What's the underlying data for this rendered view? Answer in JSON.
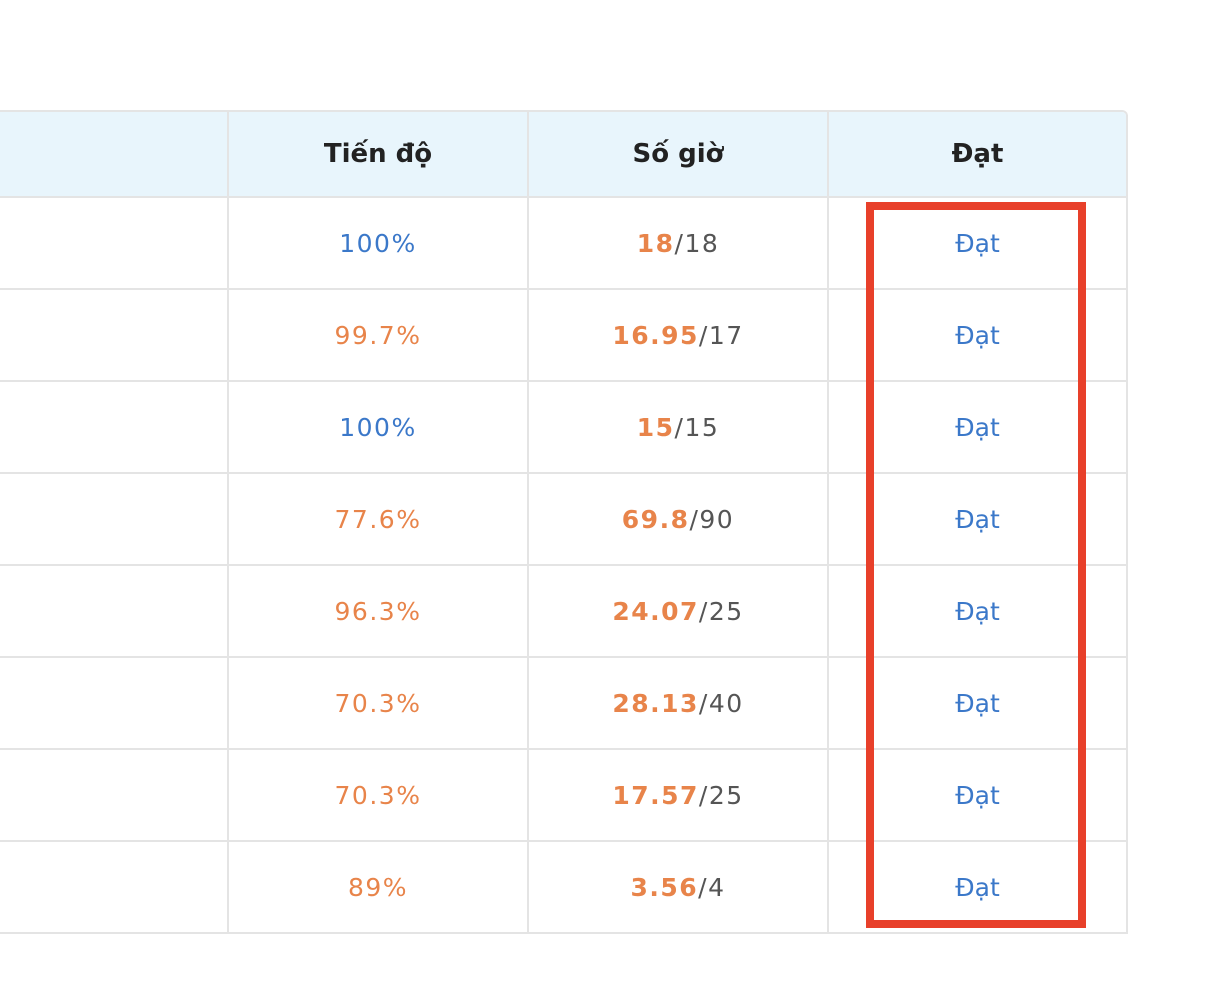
{
  "table": {
    "headers": {
      "name": "",
      "progress": "Tiến độ",
      "hours": "Số giờ",
      "pass": "Đạt"
    },
    "rows": [
      {
        "progress": "100%",
        "progress_status": "complete",
        "hours_done": "18",
        "hours_total": "18",
        "pass": "Đạt"
      },
      {
        "progress": "99.7%",
        "progress_status": "partial",
        "hours_done": "16.95",
        "hours_total": "17",
        "pass": "Đạt"
      },
      {
        "progress": "100%",
        "progress_status": "complete",
        "hours_done": "15",
        "hours_total": "15",
        "pass": "Đạt"
      },
      {
        "progress": "77.6%",
        "progress_status": "partial",
        "hours_done": "69.8",
        "hours_total": "90",
        "pass": "Đạt"
      },
      {
        "progress": "96.3%",
        "progress_status": "partial",
        "hours_done": "24.07",
        "hours_total": "25",
        "pass": "Đạt"
      },
      {
        "progress": "70.3%",
        "progress_status": "partial",
        "hours_done": "28.13",
        "hours_total": "40",
        "pass": "Đạt"
      },
      {
        "progress": "70.3%",
        "progress_status": "partial",
        "hours_done": "17.57",
        "hours_total": "25",
        "pass": "Đạt"
      },
      {
        "progress": "89%",
        "progress_status": "partial",
        "hours_done": "3.56",
        "hours_total": "4",
        "pass": "Đạt"
      }
    ],
    "hours_separator": "/"
  },
  "colors": {
    "complete": "#3b78c9",
    "partial": "#e8844a",
    "header_bg": "#e8f5fc",
    "highlight": "#e8402a"
  }
}
